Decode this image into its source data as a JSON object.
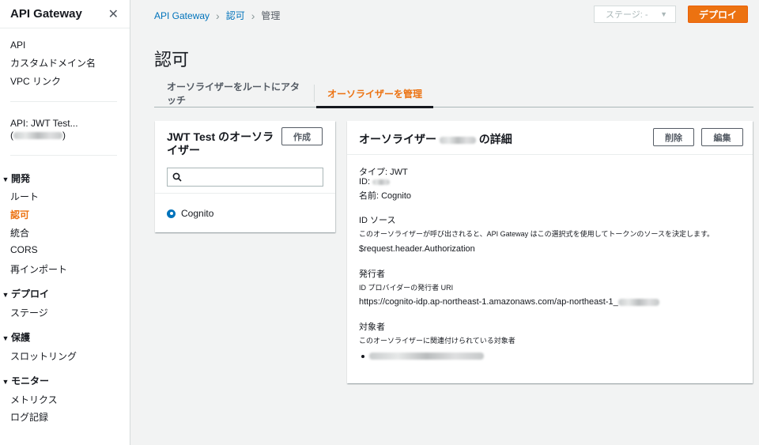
{
  "sidebar": {
    "title": "API Gateway",
    "top_links": [
      "API",
      "カスタムドメイン名",
      "VPC リンク"
    ],
    "api_name_line1": "API: JWT Test...",
    "api_id_open": "(",
    "api_id_close": ")",
    "sections": [
      {
        "label": "開発",
        "items": [
          "ルート",
          "認可",
          "統合",
          "CORS",
          "再インポート"
        ]
      },
      {
        "label": "デプロイ",
        "items": [
          "ステージ"
        ]
      },
      {
        "label": "保護",
        "items": [
          "スロットリング"
        ]
      },
      {
        "label": "モニター",
        "items": [
          "メトリクス",
          "ログ記録"
        ]
      }
    ],
    "active_item": "認可",
    "accent_color": "#ec7211"
  },
  "breadcrumb": [
    "API Gateway",
    "認可",
    "管理"
  ],
  "stage_select": {
    "value": "ステージ: -"
  },
  "deploy_button": "デプロイ",
  "page_title": "認可",
  "tabs": [
    {
      "label": "オーソライザーをルートにアタッチ",
      "active": false
    },
    {
      "label": "オーソライザーを管理",
      "active": true
    }
  ],
  "left_panel": {
    "title": "JWT Test のオーソライザー",
    "create_button": "作成",
    "search_placeholder": "",
    "items": [
      {
        "label": "Cognito",
        "selected": true
      }
    ]
  },
  "right_panel": {
    "title_prefix": "オーソライザー",
    "title_suffix": "の詳細",
    "delete_button": "削除",
    "edit_button": "編集",
    "type_line": "タイプ: JWT",
    "id_label": "ID:",
    "name_line": "名前: Cognito",
    "id_source_label": "ID ソース",
    "id_source_desc": "このオーソライザーが呼び出されると、API Gateway はこの選択式を使用してトークンのソースを決定します。",
    "id_source_value": "$request.header.Authorization",
    "issuer_label": "発行者",
    "issuer_desc": "ID プロバイダーの発行者 URI",
    "issuer_value": "https://cognito-idp.ap-northeast-1.amazonaws.com/ap-northeast-1_",
    "audience_label": "対象者",
    "audience_desc": "このオーソライザーに関連付けられている対象者"
  },
  "icons": [
    "close-icon",
    "chevron-right-icon",
    "caret-down-icon",
    "search-icon",
    "radio-selected-icon"
  ]
}
